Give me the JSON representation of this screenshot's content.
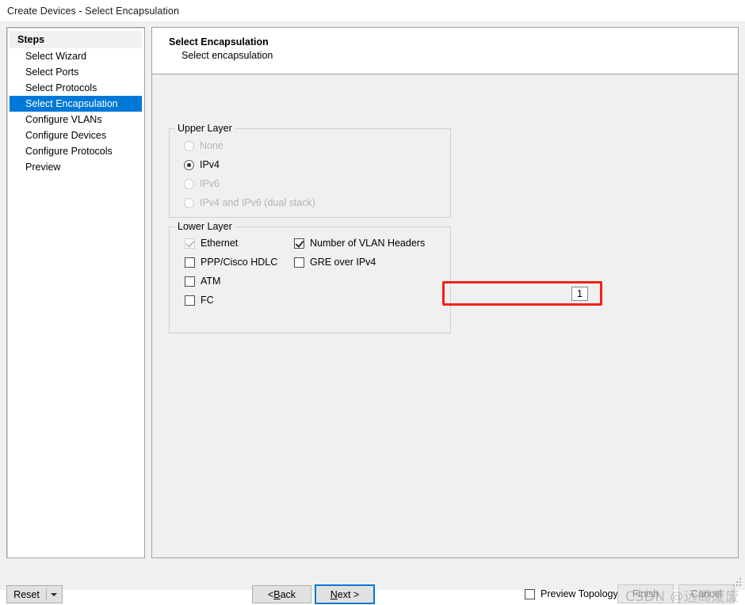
{
  "window": {
    "title": "Create Devices - Select Encapsulation"
  },
  "steps_panel": {
    "header": "Steps",
    "items": [
      {
        "label": "Select Wizard",
        "selected": false
      },
      {
        "label": "Select Ports",
        "selected": false
      },
      {
        "label": "Select Protocols",
        "selected": false
      },
      {
        "label": "Select Encapsulation",
        "selected": true
      },
      {
        "label": "Configure VLANs",
        "selected": false
      },
      {
        "label": "Configure Devices",
        "selected": false
      },
      {
        "label": "Configure Protocols",
        "selected": false
      },
      {
        "label": "Preview",
        "selected": false
      }
    ],
    "selected_label": "Select Encapsulation"
  },
  "page_header": {
    "title": "Select Encapsulation",
    "subtitle": "Select encapsulation"
  },
  "upper_layer": {
    "legend": "Upper Layer",
    "options": [
      {
        "label": "None",
        "checked": false,
        "disabled": true
      },
      {
        "label": "IPv4",
        "checked": true,
        "disabled": false
      },
      {
        "label": "IPv6",
        "checked": false,
        "disabled": true
      },
      {
        "label": "IPv4 and IPv6 (dual stack)",
        "checked": false,
        "disabled": true
      }
    ]
  },
  "lower_layer": {
    "legend": "Lower Layer",
    "left_options": [
      {
        "label": "Ethernet",
        "checked": true,
        "disabled": true
      },
      {
        "label": "PPP/Cisco HDLC",
        "checked": false,
        "disabled": false
      },
      {
        "label": "ATM",
        "checked": false,
        "disabled": false
      },
      {
        "label": "FC",
        "checked": false,
        "disabled": false
      }
    ],
    "right_options": [
      {
        "label": "Number of VLAN Headers",
        "checked": true,
        "disabled": false
      },
      {
        "label": "GRE over IPv4",
        "checked": false,
        "disabled": false
      }
    ],
    "vlan_header_count": "1"
  },
  "annotation": {
    "highlight_color": "#f32013",
    "highlight_target": "Number of VLAN Headers"
  },
  "footer": {
    "reset_label": "Reset",
    "back_label_prefix": "< ",
    "back_accel": "B",
    "back_label_suffix": "ack",
    "next_accel": "N",
    "next_label_suffix": "ext >",
    "preview_topology_label": "Preview Topology",
    "preview_topology_checked": false,
    "finish_label": "Finish",
    "cancel_label": "Cancel",
    "finish_disabled": true,
    "cancel_disabled": true
  },
  "watermark": {
    "text": "CSDN @远阁废废"
  },
  "icons": {
    "dropdown": "chevron-down-icon",
    "resize": "resize-grip-icon"
  },
  "colors": {
    "selection_blue": "#0078d7",
    "window_bg": "#f0f0f0",
    "panel_white": "#ffffff",
    "annotation_red": "#f32013",
    "disabled_text": "#b4b4b4"
  }
}
